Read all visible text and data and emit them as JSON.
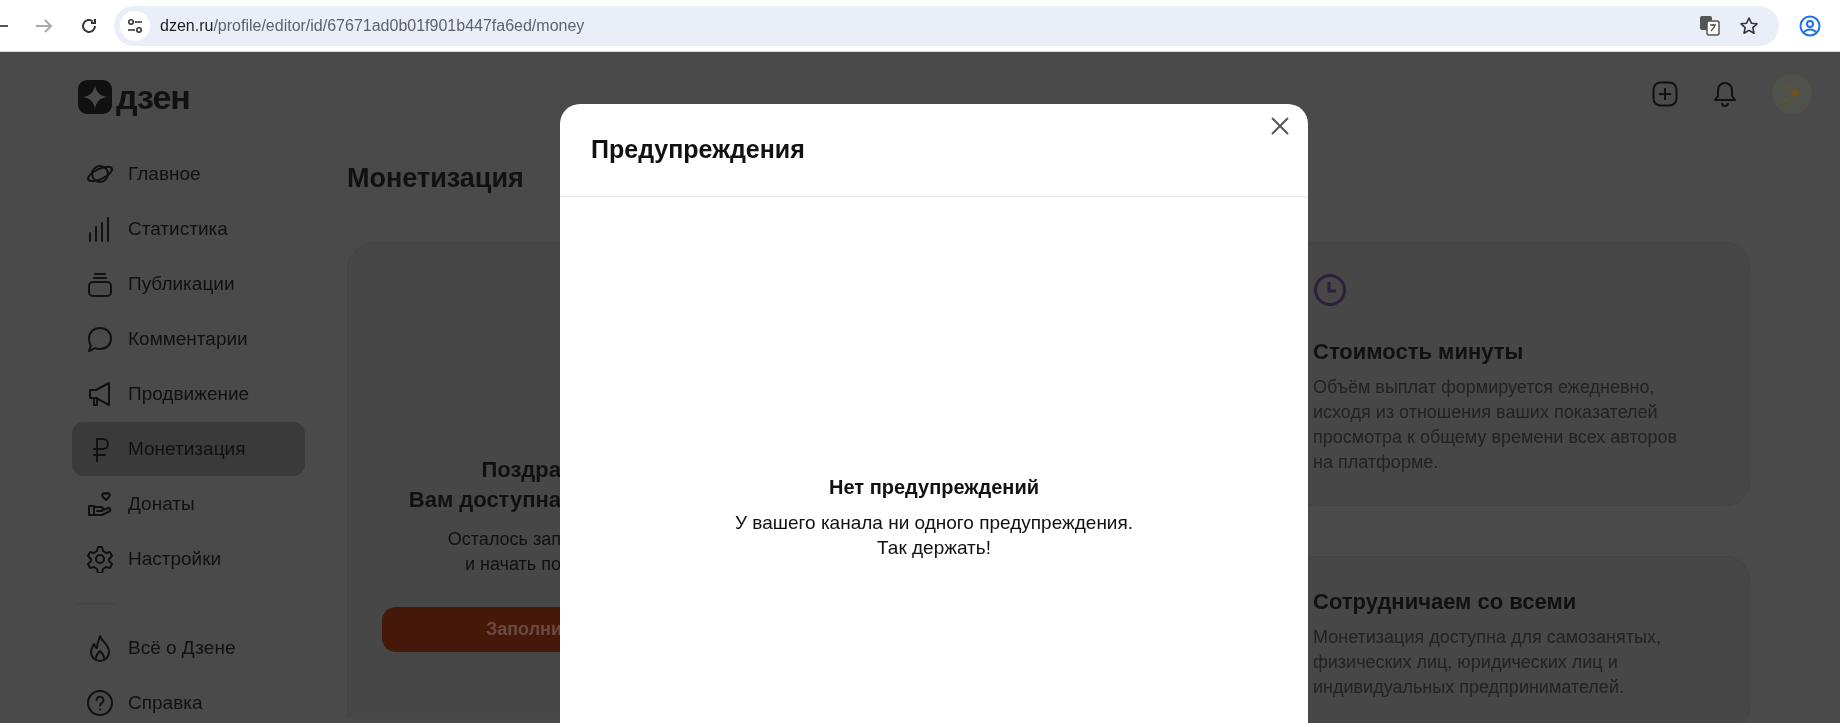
{
  "browser": {
    "url_host": "dzen.ru",
    "url_path": "/profile/editor/id/67671ad0b01f901b447fa6ed/money"
  },
  "logo": {
    "text": "дзен"
  },
  "sidebar": {
    "items": [
      {
        "label": "Главное",
        "selected": false
      },
      {
        "label": "Статистика",
        "selected": false
      },
      {
        "label": "Публикации",
        "selected": false
      },
      {
        "label": "Комментарии",
        "selected": false
      },
      {
        "label": "Продвижение",
        "selected": false
      },
      {
        "label": "Монетизация",
        "selected": true
      },
      {
        "label": "Донаты",
        "selected": false
      },
      {
        "label": "Настройки",
        "selected": false
      }
    ],
    "footer_items": [
      {
        "label": "Всё о Дзене",
        "selected": false
      },
      {
        "label": "Справка",
        "selected": false
      }
    ]
  },
  "page_title": "Монетизация",
  "offer_card": {
    "title_lines": [
      "Поздра",
      "Вам доступна"
    ],
    "text_lines": [
      "Осталось зап",
      "и начать по"
    ],
    "button": "Заполни"
  },
  "info_cards": [
    {
      "kind": "clock",
      "title": "Стоимость минуты",
      "text": "Объём выплат формируется ежедневно, исходя из отношения ваших показателей просмотра к общему времени всех авторов на платформе."
    },
    {
      "title": "Сотрудничаем со всеми",
      "text": "Монетизация доступна для самозанятых, физических лиц, юридических лиц и индивидуальных предпринимателей."
    }
  ],
  "modal": {
    "title": "Предупреждения",
    "empty_title": "Нет предупреждений",
    "empty_text": "У вашего канала ни одного предупреждения. Так держать!"
  }
}
